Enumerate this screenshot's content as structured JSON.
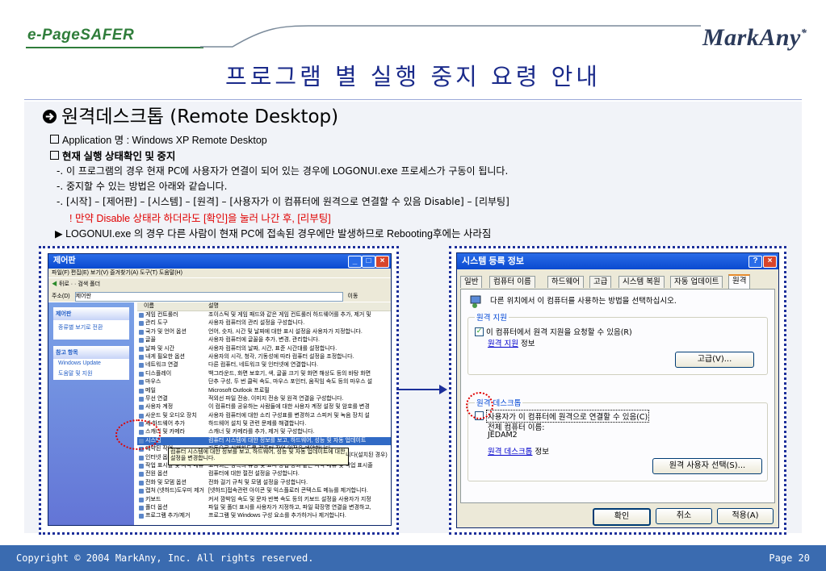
{
  "header": {
    "brand": "e-PageSAFER",
    "logo": "MarkAny",
    "logo_mark": "*",
    "title": "프로그램 별 실행 중지 요령 안내"
  },
  "section": {
    "heading": "원격데스크톱 (Remote Desktop)",
    "heading_icon": "right-arrow-circle-icon",
    "app_line": "Application 명 : Windows XP Remote Desktop",
    "status_heading": "현재 실행 상태확인 및 중지",
    "desc1": "-. 이 프로그램의 경우 현재 PC에 사용자가 연결이 되어 있는 경우에 LOGONUI.exe 프로세스가 구동이 됩니다.",
    "desc2": "-. 중지할 수 있는 방법은 아래와 같습니다.",
    "desc3": "-. [시작] – [제어판] – [시스템] – [원격] – [사용자가 이 컴퓨터에 원격으로 연결할 수 있음 Disable] – [리부팅]",
    "warning": "! 만약 Disable 상태라 하더라도 [확인]을 눌러 나간 후, [리부팅]",
    "note": "▶ LOGONUI.exe 의 경우 다른 사람이 현재 PC에 접속된 경우에만 발생하므로 Rebooting후에는 사라짐"
  },
  "control_panel": {
    "title": "제어판",
    "menu": "파일(F)  편집(E)  보기(V)  즐겨찾기(A)  도구(T)  도움말(H)",
    "toolbar": "뒤로 ·  ·  검색  폴더",
    "address_label": "주소(D)",
    "address_value": "제어판",
    "go": "이동",
    "left_panel_title": "제어판",
    "left_switch": "종류별 보기로 전환",
    "left_see_also": "참고 항목",
    "left_links": [
      "Windows Update",
      "도움말 및 지원"
    ],
    "col_name": "이름",
    "col_desc": "설명",
    "rows": [
      [
        "게임 컨트롤러",
        "조이스틱 및 게임 패드와 같은 게임 컨트롤러 하드웨어를 추가, 제거 및"
      ],
      [
        "관리 도구",
        "사용자 컴퓨터의 관리 설정을 구성합니다."
      ],
      [
        "국가 및 언어 옵션",
        "언어, 숫자, 시간 및 날짜에 대한 표시 설정을 사용자가 지정합니다."
      ],
      [
        "글꼴",
        "사용자 컴퓨터에 글꼴을 추가, 변경, 관리합니다."
      ],
      [
        "날짜 및 시간",
        "사용자 컴퓨터의 날짜, 시간, 표준 시간대를 설정합니다."
      ],
      [
        "내게 필요한 옵션",
        "사용자의 시각, 청각, 기동성에 따라 컴퓨터 설정을 조정합니다."
      ],
      [
        "네트워크 연결",
        "다른 컴퓨터, 네트워크 및 인터넷에 연결합니다."
      ],
      [
        "디스플레이",
        "백그라운드, 화면 보호기, 색, 글꼴 크기 및 화면 해상도 등의 바탕 화면"
      ],
      [
        "마우스",
        "단추 구성, 두 번 클릭 속도, 마우스 포인터, 움직임 속도 등의 마우스 설"
      ],
      [
        "메일",
        "Microsoft Outlook 프로필"
      ],
      [
        "무선 연결",
        "적외선 파일 전송, 이미지 전송 및 원격 연결을 구성합니다."
      ],
      [
        "사용자 계정",
        "이 컴퓨터를 공유하는 사람들에 대한 사용자 계정 설정 및 암호를 변경"
      ],
      [
        "사운드 및 오디오 장치",
        "사용자 컴퓨터에 대한 소리 구성표를 변경하고 스피커 및 녹음 장치 설"
      ],
      [
        "새 하드웨어 추가",
        "하드웨어 설치 및 관련 문제를 해결합니다."
      ],
      [
        "스캐너 및 카메라",
        "스캐너 및 카메라를 추가, 제거 및 구성합니다."
      ],
      [
        "시스템",
        "컴퓨터 시스템에 대한 정보를 보고, 하드웨어, 성능 및 자동 업데이트"
      ],
      [
        "예약된 작업",
        "자동으로 실행하도록 컴퓨터 작업 일정을 예약합니다."
      ],
      [
        "인터넷 옵션",
        "인터넷 표시 및 연결 설정을 구성합니다."
      ],
      [
        "작업 표시줄 및 시작 메뉴",
        "표시되는 항목의 유형 및 표시 방법 등과 같은 시작 메뉴 및 작업 표시줄"
      ],
      [
        "전원 옵션",
        "컴퓨터에 대한 절전 설정을 구성합니다."
      ],
      [
        "전화 및 모뎀 옵션",
        "전화 걸기 규칙 및 모뎀 설정을 구성합니다."
      ],
      [
        "캡처 (넷하드)도우미 제거",
        "[넷하드]접속관련 아이콘 및 익스플로러 콘텍스트 메뉴를 제거합니다."
      ],
      [
        "키보드",
        "커서 깜박임 속도 및 문자 반복 속도 등의 키보드 설정을 사용자가 지정"
      ],
      [
        "폴더 옵션",
        "파일 및 폴더 표시를 사용자가 지정하고, 파일 확장명 연결을 변경하고,"
      ],
      [
        "프로그램 추가/제거",
        "프로그램 및 Windows 구성 요소를 추가하거나 제거합니다."
      ]
    ],
    "tooltip": "컴퓨터 시스템에 대한 정보를 보고, 하드웨어, 성능 및 자동 업데이트에 대한 설정을 변경합니다.",
    "tooltip_tail": "니다(설치된 경우)"
  },
  "system_props": {
    "title": "시스템 등록 정보",
    "tabs": [
      "일반",
      "컴퓨터 이름",
      "하드웨어",
      "고급",
      "시스템 복원",
      "자동 업데이트",
      "원격"
    ],
    "intro": "다른 위치에서 이 컴퓨터를 사용하는 방법을 선택하십시오.",
    "group1_title": "원격 지원",
    "group1_check": "이 컴퓨터에서 원격 지원을 요청할 수 있음(R)",
    "group1_link": "원격 지원",
    "group1_link_suffix": " 정보",
    "advanced_btn": "고급(V)...",
    "group2_title": "원격 데스크톱",
    "group2_check": "사용자가 이 컴퓨터에 원격으로 연결할 수 있음(C)",
    "computer_name_label": "전체 컴퓨터 이름:",
    "computer_name": "JEDAM2",
    "group2_link": "원격 데스크톱",
    "group2_link_suffix": " 정보",
    "select_users_btn": "원격 사용자 선택(S)...",
    "ok": "확인",
    "cancel": "취소",
    "apply": "적용(A)"
  },
  "footer": {
    "copyright": "Copyright © 2004 MarkAny, Inc. All rights reserved.",
    "page": "Page 20"
  }
}
